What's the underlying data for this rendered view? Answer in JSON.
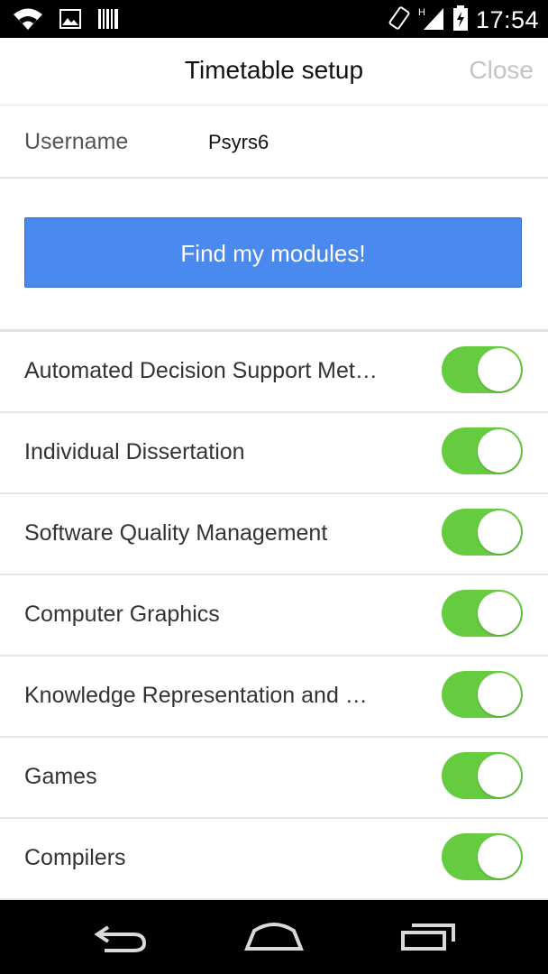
{
  "status_bar": {
    "time": "17:54",
    "left_icons": [
      "wifi-icon",
      "image-icon",
      "barcode-icon"
    ],
    "right_icons": [
      "rotate-icon",
      "signal-icon",
      "battery-icon"
    ]
  },
  "header": {
    "title": "Timetable setup",
    "close_label": "Close"
  },
  "user": {
    "label": "Username",
    "value": "Psyrs6"
  },
  "find_button": {
    "label": "Find my modules!",
    "color": "#4a89ee"
  },
  "modules": [
    {
      "label": "Automated Decision Support Met…",
      "enabled": true
    },
    {
      "label": "Individual Dissertation",
      "enabled": true
    },
    {
      "label": "Software Quality Management",
      "enabled": true
    },
    {
      "label": "Computer Graphics",
      "enabled": true
    },
    {
      "label": "Knowledge Representation and …",
      "enabled": true
    },
    {
      "label": "Games",
      "enabled": true
    },
    {
      "label": "Compilers",
      "enabled": true
    }
  ],
  "toggle_color": "#66cc3f",
  "nav_bar": {
    "icons": [
      "back-icon",
      "home-icon",
      "recent-apps-icon"
    ]
  }
}
